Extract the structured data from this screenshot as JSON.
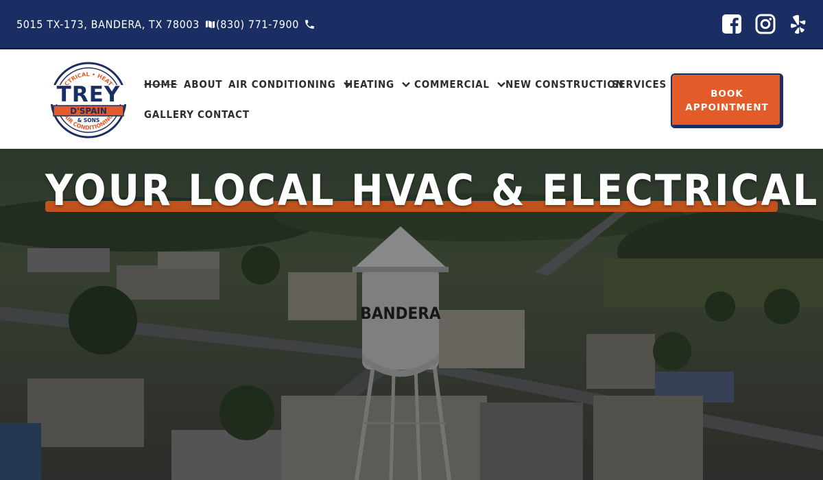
{
  "topbar": {
    "address": "5015 TX-173, BANDERA, TX 78003",
    "address_icon": "map-icon",
    "phone": "(830) 771-7900",
    "phone_icon": "phone-icon",
    "social": [
      "facebook-icon",
      "instagram-icon",
      "yelp-icon"
    ],
    "background": "#1a2e63"
  },
  "logo": {
    "top_arc": "ELECTRICAL • HEATING",
    "name": "TREY",
    "banner": "D'SPAIN",
    "sub": "& SONS",
    "bottom_arc": "AIR CONDITIONING"
  },
  "nav": {
    "home": "HOME",
    "about": "ABOUT",
    "air_conditioning": "AIR CONDITIONING",
    "heating": "HEATING",
    "commercial": "COMMERCIAL",
    "new_construction": "NEW CONSTRUCTION",
    "services": "SERVICES",
    "gallery": "GALLERY",
    "contact": "CONTACT"
  },
  "cta": {
    "line1": "BOOK",
    "line2": "APPOINTMENT",
    "color": "#e35b28"
  },
  "hero": {
    "title": "YOUR LOCAL HVAC & ELECTRICAL PROS",
    "tower_text": "BANDERA",
    "accent": "#c2521d"
  }
}
